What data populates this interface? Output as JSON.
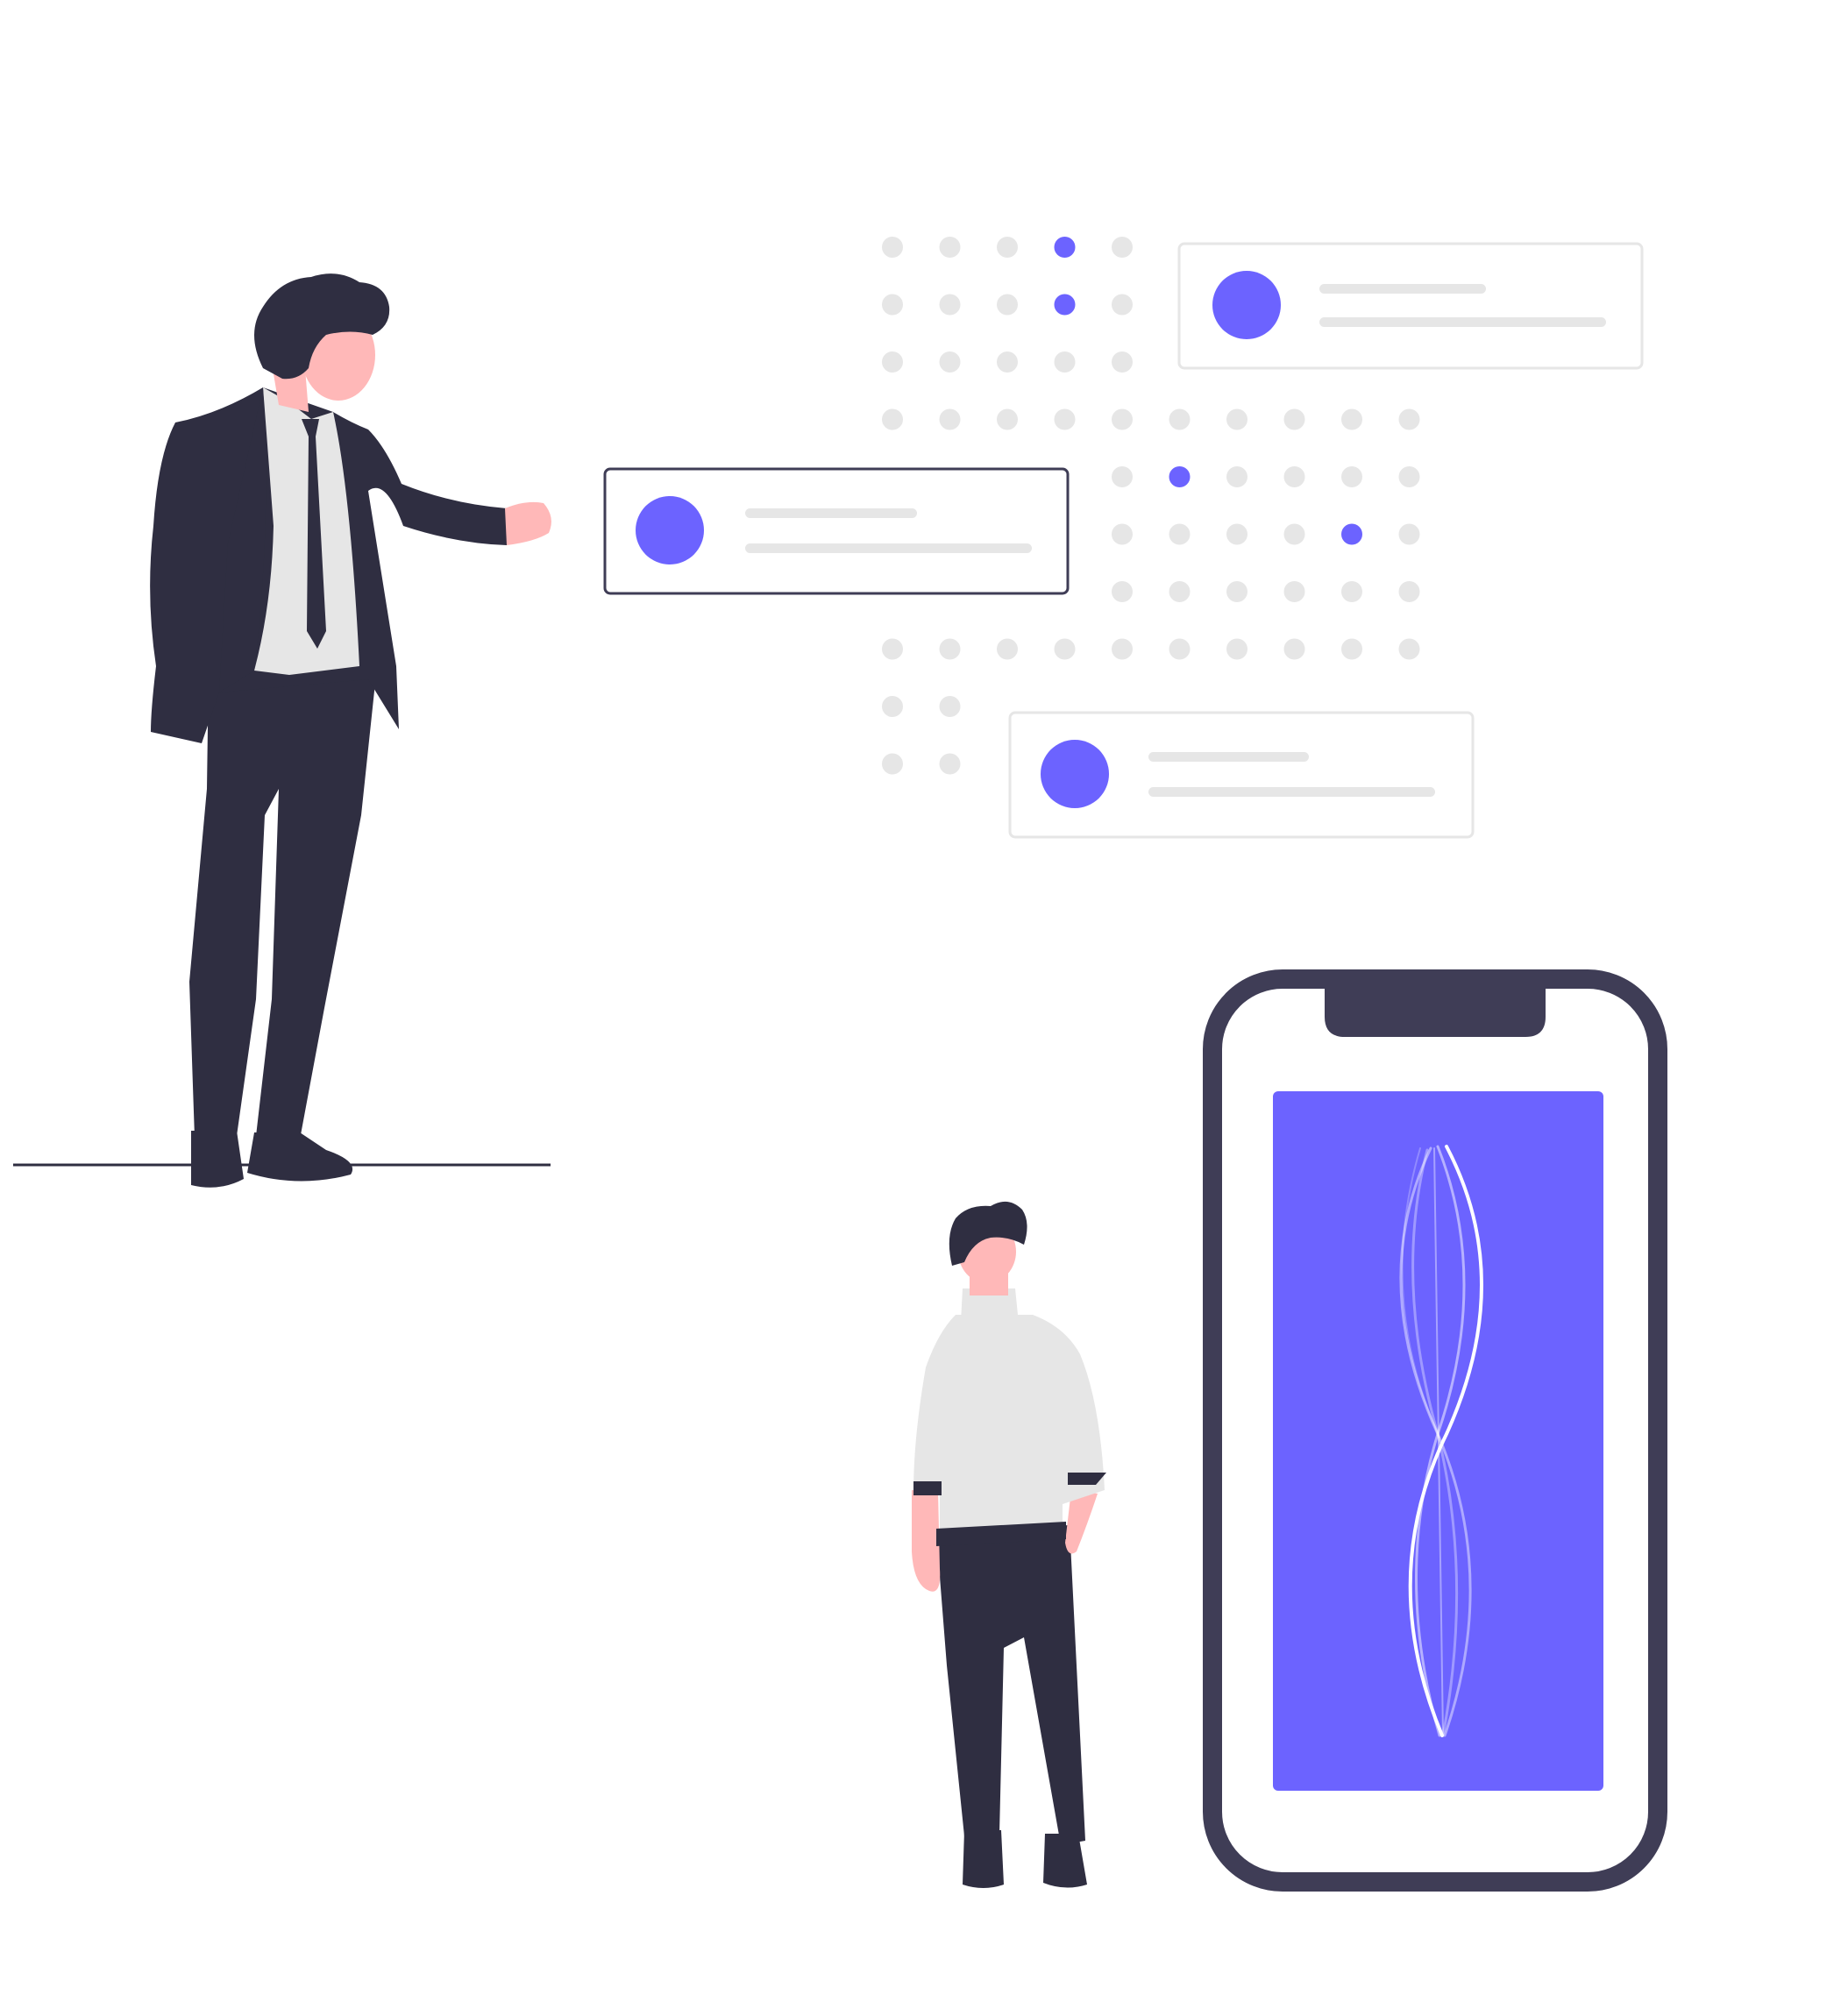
{
  "colors": {
    "accent": "#6c63ff",
    "dark": "#2f2e41",
    "dark_outline": "#3f3d56",
    "skin": "#ffb8b8",
    "light_gray": "#e6e6e6",
    "card_border": "#e6e6e6",
    "white": "#ffffff"
  },
  "dot_grid": {
    "rows": [
      {
        "cols": [
          0,
          1,
          2,
          3,
          4
        ],
        "accent": [
          3
        ]
      },
      {
        "cols": [
          0,
          1,
          2,
          3,
          4
        ],
        "accent": [
          3
        ]
      },
      {
        "cols": [
          0,
          1,
          2,
          3,
          4
        ],
        "accent": []
      },
      {
        "cols": [
          0,
          1,
          2,
          3,
          4,
          5,
          6,
          7,
          8,
          9
        ],
        "accent": []
      },
      {
        "cols": [
          4,
          5,
          6,
          7,
          8,
          9
        ],
        "accent": [
          5
        ]
      },
      {
        "cols": [
          4,
          5,
          6,
          7,
          8,
          9
        ],
        "accent": [
          8
        ]
      },
      {
        "cols": [
          4,
          5,
          6,
          7,
          8,
          9
        ],
        "accent": []
      },
      {
        "cols": [
          0,
          1,
          2,
          3,
          4,
          5,
          6,
          7,
          8,
          9
        ],
        "accent": []
      },
      {
        "cols": [
          0,
          1
        ],
        "accent": []
      },
      {
        "cols": [
          0,
          1
        ],
        "accent": []
      }
    ]
  },
  "cards": [
    {
      "name": "card-top-right",
      "highlighted": false
    },
    {
      "name": "card-middle",
      "highlighted": true
    },
    {
      "name": "card-bottom",
      "highlighted": false
    }
  ],
  "icons": {
    "phone": "smartphone-icon",
    "waveform": "waveform-icon"
  }
}
